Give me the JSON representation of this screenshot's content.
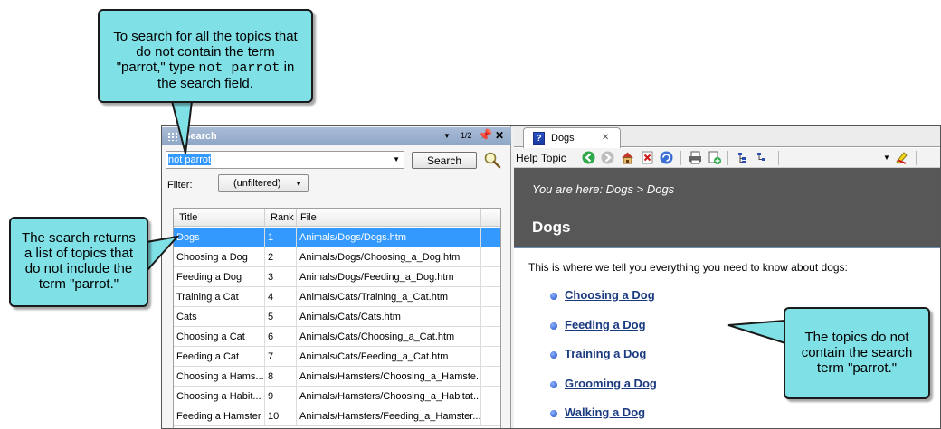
{
  "search_pane": {
    "title": "Search",
    "page_indicator": "1/2",
    "query": "not parrot",
    "search_button": "Search",
    "filter_label": "Filter:",
    "filter_value": "(unfiltered)",
    "columns": [
      "Title",
      "Rank",
      "File"
    ],
    "rows": [
      {
        "title": "Dogs",
        "rank": "1",
        "file": "Animals/Dogs/Dogs.htm"
      },
      {
        "title": "Choosing a Dog",
        "rank": "2",
        "file": "Animals/Dogs/Choosing_a_Dog.htm"
      },
      {
        "title": "Feeding a Dog",
        "rank": "3",
        "file": "Animals/Dogs/Feeding_a_Dog.htm"
      },
      {
        "title": "Training a Cat",
        "rank": "4",
        "file": "Animals/Cats/Training_a_Cat.htm"
      },
      {
        "title": "Cats",
        "rank": "5",
        "file": "Animals/Cats/Cats.htm"
      },
      {
        "title": "Choosing a Cat",
        "rank": "6",
        "file": "Animals/Cats/Choosing_a_Cat.htm"
      },
      {
        "title": "Feeding a Cat",
        "rank": "7",
        "file": "Animals/Cats/Feeding_a_Cat.htm"
      },
      {
        "title": "Choosing a Hams...",
        "rank": "8",
        "file": "Animals/Hamsters/Choosing_a_Hamste..."
      },
      {
        "title": "Choosing a Habit...",
        "rank": "9",
        "file": "Animals/Hamsters/Choosing_a_Habitat..."
      },
      {
        "title": "Feeding a Hamster",
        "rank": "10",
        "file": "Animals/Hamsters/Feeding_a_Hamster...."
      }
    ]
  },
  "help_pane": {
    "tab_label": "Dogs",
    "toolbar_label": "Help Topic",
    "breadcrumb": "You are here: Dogs > Dogs",
    "title": "Dogs",
    "intro": "This is where we tell you everything you need to know about dogs:",
    "links": [
      "Choosing a Dog",
      "Feeding a Dog",
      "Training a Dog",
      "Grooming a Dog",
      "Walking a Dog"
    ]
  },
  "callouts": {
    "top_line1": "To search for all the topics that",
    "top_line2": "do not contain the term",
    "top_line3a": "\"parrot,\" type ",
    "top_code": "not parrot",
    "top_line3b": " in",
    "top_line4": "the search field.",
    "left_line1": "The search returns",
    "left_line2": "a list of topics that",
    "left_line3": "do not include the",
    "left_line4": "term \"parrot.\"",
    "right_line1": "The topics do not",
    "right_line2": "contain the search",
    "right_line3": "term \"parrot.\""
  },
  "colors": {
    "callout_fill": "#7fe0e6",
    "selection": "#3399ff",
    "header_bar": "#575757",
    "link": "#1a3a80"
  }
}
